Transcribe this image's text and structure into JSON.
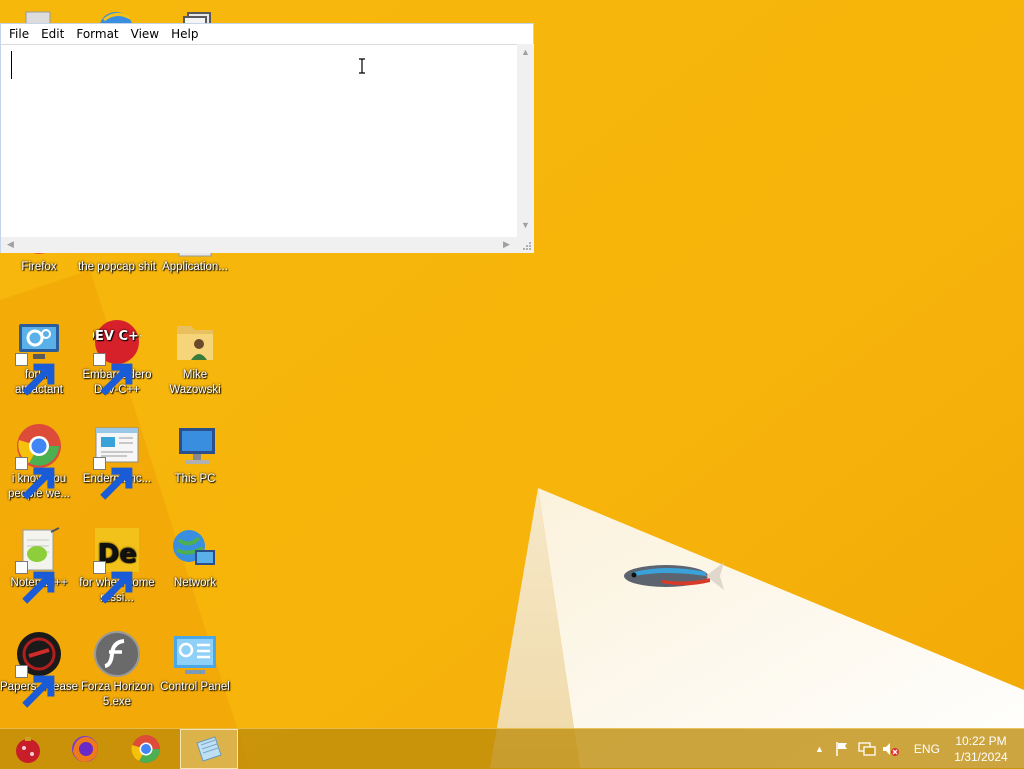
{
  "notepad": {
    "menu": [
      "File",
      "Edit",
      "Format",
      "View",
      "Help"
    ],
    "content": ""
  },
  "desktop": {
    "icons": [
      {
        "label": "Firefox",
        "icon": "firefox-icon"
      },
      {
        "label": "the popcap shit",
        "icon": "folder-icon"
      },
      {
        "label": "Application...",
        "icon": "application-icon"
      },
      {
        "label": "forkie attractant",
        "icon": "settings-monitor-icon"
      },
      {
        "label": "Embarcadero Dev-C++",
        "icon": "devcpp-icon"
      },
      {
        "label": "Mike Wazowski",
        "icon": "user-folder-icon"
      },
      {
        "label": "i know you people we...",
        "icon": "chrome-icon"
      },
      {
        "label": "Endermanc...",
        "icon": "window-icon"
      },
      {
        "label": "This PC",
        "icon": "computer-icon"
      },
      {
        "label": "Notepad++",
        "icon": "notepadpp-icon"
      },
      {
        "label": "for when some russi...",
        "icon": "de-icon"
      },
      {
        "label": "Network",
        "icon": "network-icon"
      },
      {
        "label": "Papers, Please",
        "icon": "papers-please-icon"
      },
      {
        "label": "Forza Horizon 5.exe",
        "icon": "flash-icon"
      },
      {
        "label": "Control Panel",
        "icon": "control-panel-icon"
      }
    ],
    "devcpp_text": "DEV C++",
    "de_text": "De"
  },
  "taskbar": {
    "pinned": [
      "ornament-icon",
      "firefox-icon",
      "chrome-icon",
      "notepad-icon"
    ],
    "language": "ENG",
    "time": "10:22 PM",
    "date": "1/31/2024"
  },
  "colors": {
    "wallpaper": "#f5b50a",
    "taskbar": "#be8c0a"
  }
}
